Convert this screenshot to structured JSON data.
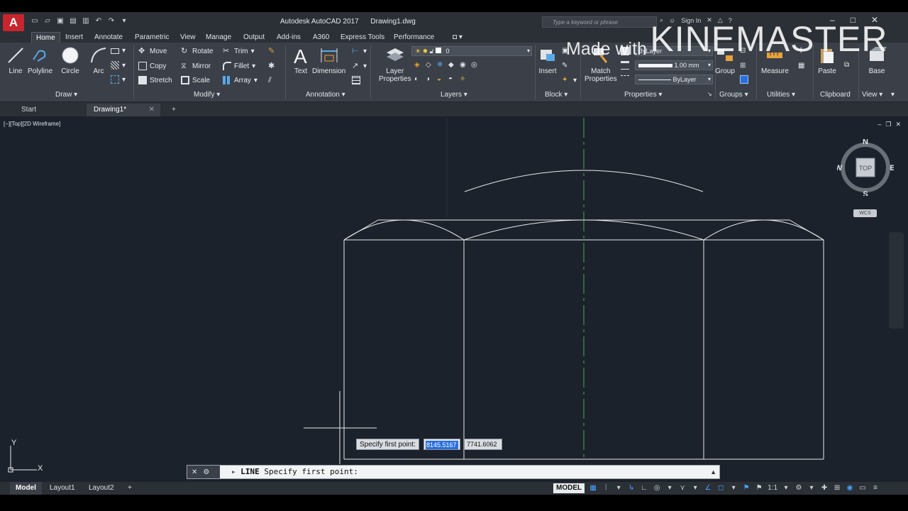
{
  "app": {
    "logo": "A",
    "title": "Autodesk AutoCAD 2017",
    "document": "Drawing1.dwg",
    "search_placeholder": "Type a keyword or phrase",
    "sign_in": "Sign In"
  },
  "ribbon_tabs": [
    "Home",
    "Insert",
    "Annotate",
    "Parametric",
    "View",
    "Manage",
    "Output",
    "Add-ins",
    "A360",
    "Express Tools",
    "Performance"
  ],
  "ribbon": {
    "draw": {
      "title": "Draw",
      "line": "Line",
      "polyline": "Polyline",
      "circle": "Circle",
      "arc": "Arc"
    },
    "modify": {
      "title": "Modify",
      "move": "Move",
      "rotate": "Rotate",
      "trim": "Trim",
      "copy": "Copy",
      "mirror": "Mirror",
      "fillet": "Fillet",
      "stretch": "Stretch",
      "scale": "Scale",
      "array": "Array"
    },
    "annotation": {
      "title": "Annotation",
      "text": "Text",
      "dimension": "Dimension"
    },
    "layers": {
      "title": "Layers",
      "layer_properties_1": "Layer",
      "layer_properties_2": "Properties",
      "current_layer": "0"
    },
    "block": {
      "title": "Block",
      "insert": "Insert"
    },
    "properties": {
      "title": "Properties",
      "match_1": "Match",
      "match_2": "Properties",
      "color": "ByLayer",
      "lineweight": "1.00 mm",
      "linetype": "ByLayer"
    },
    "groups": {
      "title": "Groups",
      "group": "Group"
    },
    "utilities": {
      "title": "Utilities",
      "measure": "Measure"
    },
    "clipboard": {
      "title": "Clipboard",
      "paste": "Paste"
    },
    "view": {
      "title": "View",
      "base": "Base"
    }
  },
  "file_tabs": [
    "Start",
    "Drawing1*"
  ],
  "viewport": {
    "label": "[−][Top][2D Wireframe]",
    "viewcube": {
      "north": "N",
      "south": "S",
      "east": "E",
      "west": "W",
      "face": "TOP",
      "wcs": "WCS"
    }
  },
  "dynamic_input": {
    "prompt": "Specify first point:",
    "x_value": "8145.5167",
    "y_value": "7741.6062"
  },
  "command_line": {
    "command": "LINE",
    "prompt": "Specify first point:"
  },
  "status_bar": {
    "layout_tabs": [
      "Model",
      "Layout1",
      "Layout2"
    ],
    "space": "MODEL",
    "scale": "1:1"
  },
  "watermark": {
    "prefix": "Made with",
    "brand": "KINEMASTER"
  }
}
